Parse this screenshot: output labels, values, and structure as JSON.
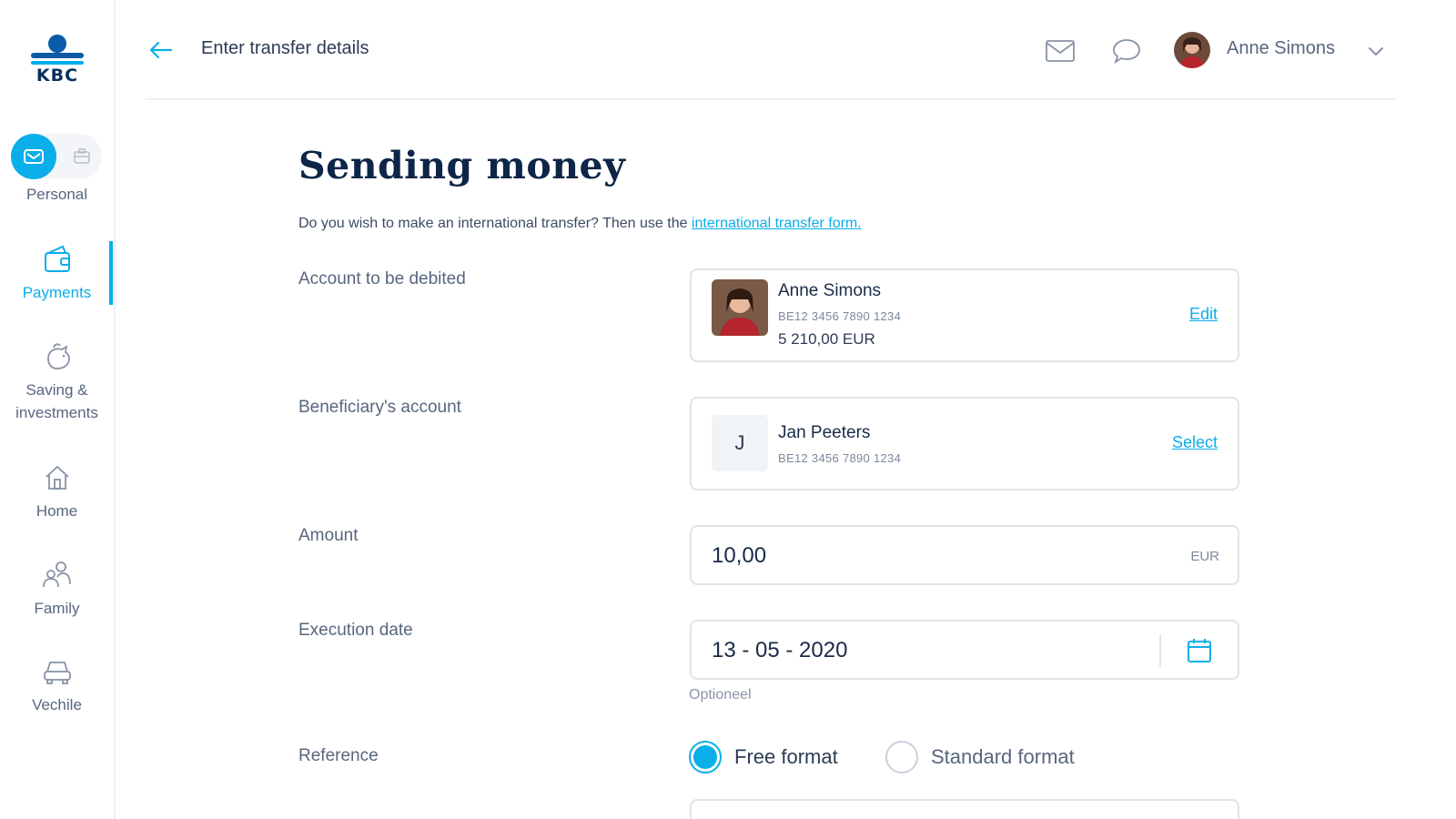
{
  "brand": {
    "logo_text": "KBC",
    "accent_color": "#0aaee8",
    "navy_color": "#0d2547"
  },
  "sidebar": {
    "profile_label": "Personal",
    "items": [
      {
        "label": "Payments",
        "icon": "wallet-icon",
        "active": true
      },
      {
        "label": "Saving &",
        "label2": "investments",
        "icon": "piggy-bank-icon",
        "active": false
      },
      {
        "label": "Home",
        "icon": "home-icon",
        "active": false
      },
      {
        "label": "Family",
        "icon": "family-icon",
        "active": false
      },
      {
        "label": "Vechile",
        "icon": "car-icon",
        "active": false
      }
    ]
  },
  "header": {
    "step_title": "Enter transfer details",
    "user_name": "Anne Simons",
    "icons": [
      "back-arrow-icon",
      "mail-icon",
      "chat-icon",
      "chevron-down-icon"
    ]
  },
  "main": {
    "title": "Sending money",
    "intro_text": "Do you wish to make an international transfer? Then use the ",
    "intro_link": "international transfer form.",
    "debit": {
      "label": "Account to be debited",
      "name": "Anne Simons",
      "iban": "BE12 3456 7890 1234",
      "balance": "5 210,00 EUR",
      "action": "Edit"
    },
    "beneficiary": {
      "label": "Beneficiary's account",
      "initial": "J",
      "name": "Jan Peeters",
      "iban": "BE12 3456 7890 1234",
      "action": "Select"
    },
    "amount": {
      "label": "Amount",
      "value": "10,00",
      "currency": "EUR"
    },
    "execution_date": {
      "label": "Execution date",
      "value": "13 - 05 - 2020",
      "hint": "Optioneel"
    },
    "reference": {
      "label": "Reference",
      "options": [
        {
          "label": "Free format",
          "checked": true
        },
        {
          "label": "Standard format",
          "checked": false
        }
      ]
    }
  }
}
